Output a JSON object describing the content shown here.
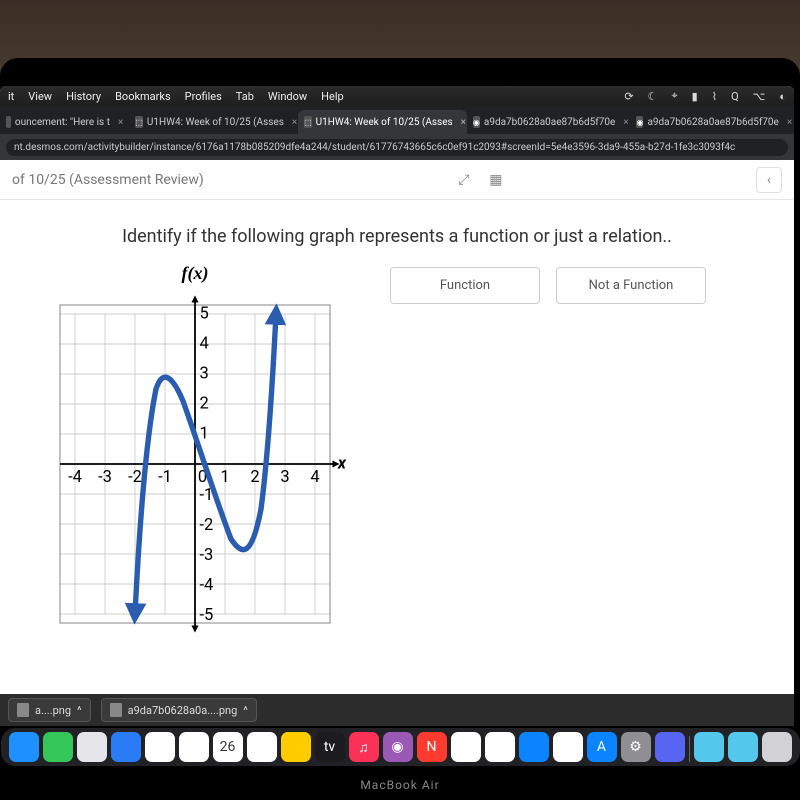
{
  "mac_menu": {
    "items": [
      "it",
      "View",
      "History",
      "Bookmarks",
      "Profiles",
      "Tab",
      "Window",
      "Help"
    ],
    "status_icons": [
      "sync-icon",
      "moon-icon",
      "bluetooth-icon",
      "battery-icon",
      "wifi-icon",
      "search-icon",
      "control-center-icon",
      "siri-icon"
    ]
  },
  "chrome": {
    "tabs": [
      {
        "label": "ouncement: \"Here is t",
        "active": false
      },
      {
        "label": "U1HW4: Week of 10/25 (Asses",
        "active": false
      },
      {
        "label": "U1HW4: Week of 10/25 (Asses",
        "active": true
      },
      {
        "label": "a9da7b0628a0ae87b6d5f70e",
        "active": false
      },
      {
        "label": "a9da7b0628a0ae87b6d5f70e",
        "active": false
      }
    ],
    "url": "nt.desmos.com/activitybuilder/instance/6176a1178b085209dfe4a244/student/61776743665c6c0ef91c2093#screenId=5e4e3596-3da9-455a-b27d-1fe3c3093f4c"
  },
  "page": {
    "title_fragment": "of 10/25 (Assessment Review)",
    "question": "Identify if the following graph represents a function or just a relation..",
    "y_axis_title": "f(x)",
    "answers": [
      "Function",
      "Not a Function"
    ],
    "back_icon": "‹"
  },
  "downloads": {
    "items": [
      "a....png",
      "a9da7b0628a0a....png"
    ]
  },
  "dock": {
    "apps": [
      {
        "name": "finder",
        "bg": "#1e90ff"
      },
      {
        "name": "messages",
        "bg": "#34c759"
      },
      {
        "name": "safari",
        "bg": "#e5e5ea"
      },
      {
        "name": "mail",
        "bg": "#2a7cf6"
      },
      {
        "name": "maps",
        "bg": "#ffffff"
      },
      {
        "name": "photos",
        "bg": "#ffffff"
      },
      {
        "name": "calendar",
        "bg": "#ffffff",
        "text": "26"
      },
      {
        "name": "reminders",
        "bg": "#ffffff"
      },
      {
        "name": "notes",
        "bg": "#ffcc00"
      },
      {
        "name": "appletv",
        "bg": "#1c1c1e",
        "text": "tv"
      },
      {
        "name": "music",
        "bg": "#fc3158",
        "text": "♫"
      },
      {
        "name": "podcasts",
        "bg": "#9b59b6",
        "text": "◉"
      },
      {
        "name": "news",
        "bg": "#ff3b30",
        "text": "N"
      },
      {
        "name": "numbers",
        "bg": "#ffffff"
      },
      {
        "name": "pages",
        "bg": "#ffffff"
      },
      {
        "name": "keynote",
        "bg": "#0a84ff"
      },
      {
        "name": "chrome",
        "bg": "#ffffff"
      },
      {
        "name": "appstore",
        "bg": "#0a84ff",
        "text": "A"
      },
      {
        "name": "settings",
        "bg": "#8e8e93",
        "text": "⚙"
      },
      {
        "name": "discord",
        "bg": "#5865f2"
      },
      {
        "name": "sep",
        "bg": "transparent"
      },
      {
        "name": "folder1",
        "bg": "#54c7ec"
      },
      {
        "name": "folder2",
        "bg": "#54c7ec"
      },
      {
        "name": "trash",
        "bg": "#d1d1d6"
      }
    ]
  },
  "laptop_label": "MacBook Air",
  "chart_data": {
    "type": "line",
    "title": "f(x)",
    "xlabel": "x",
    "ylabel": "f(x)",
    "xlim": [
      -4.5,
      4.5
    ],
    "ylim": [
      -5.5,
      5.5
    ],
    "x_ticks": [
      -4,
      -3,
      -2,
      -1,
      0,
      1,
      2,
      3,
      4
    ],
    "y_ticks": [
      -5,
      -4,
      -3,
      -2,
      -1,
      1,
      2,
      3,
      4,
      5
    ],
    "series": [
      {
        "name": "curve",
        "x": [
          -2.0,
          -1.8,
          -1.5,
          -1.2,
          -1.0,
          -0.5,
          0.0,
          0.5,
          1.0,
          1.5,
          1.8,
          2.1,
          2.3,
          2.5,
          2.7
        ],
        "y": [
          -5.0,
          -2.0,
          1.0,
          2.7,
          3.0,
          2.2,
          1.0,
          -0.8,
          -2.3,
          -3.0,
          -2.8,
          -1.5,
          0.5,
          3.0,
          5.0
        ]
      }
    ],
    "arrows": [
      "start",
      "end",
      "x-positive",
      "y-positive",
      "y-negative"
    ]
  }
}
